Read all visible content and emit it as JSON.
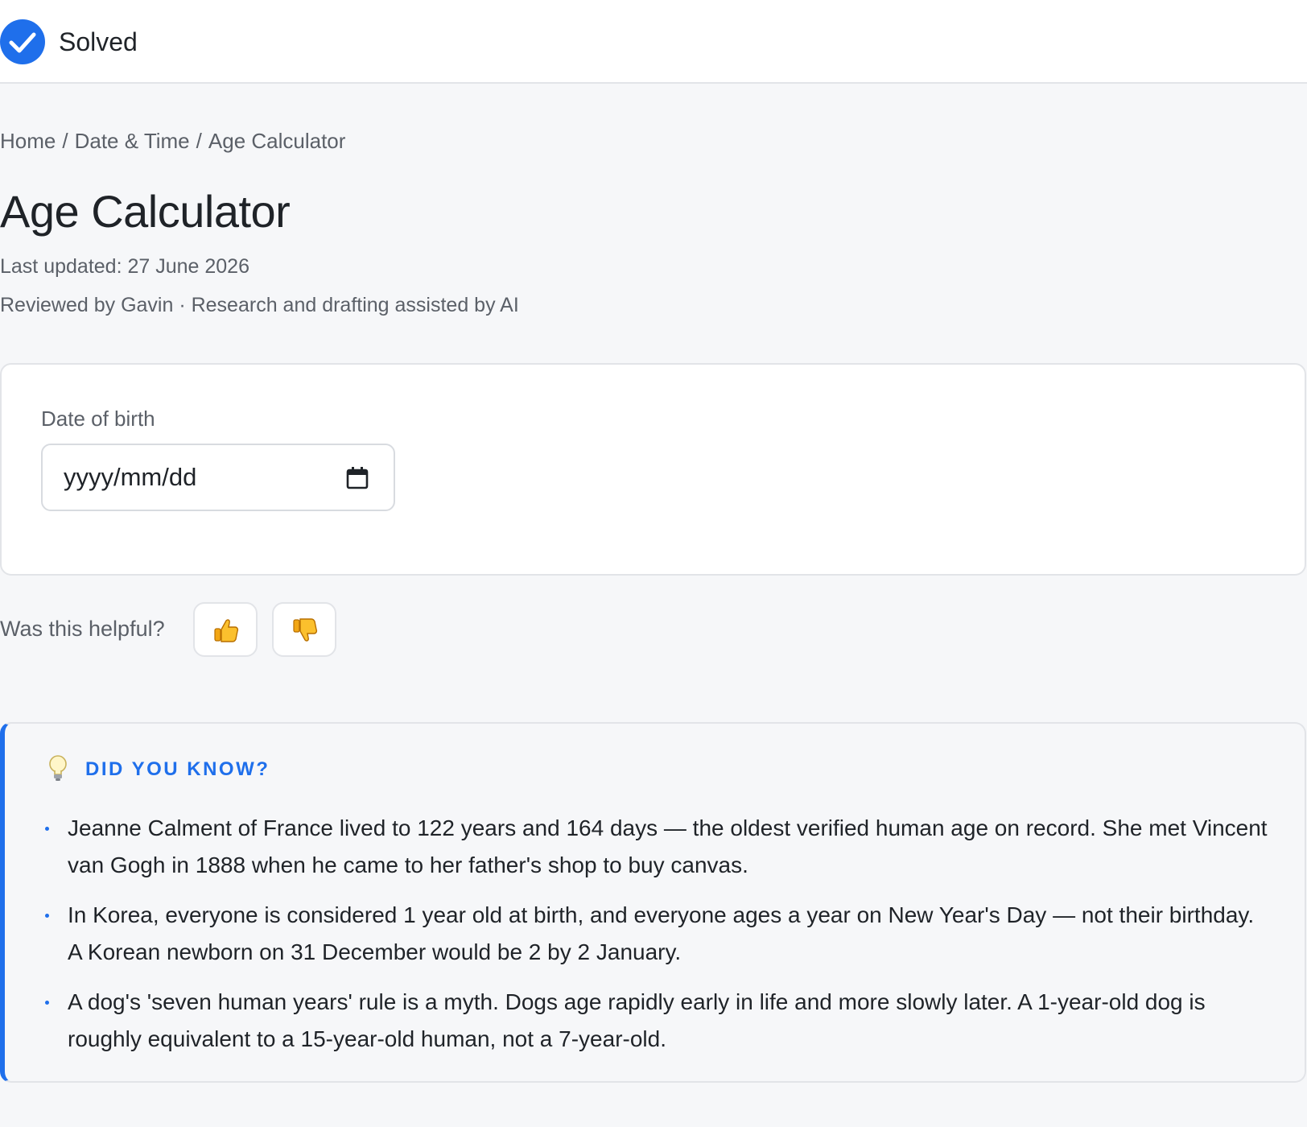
{
  "header": {
    "status_label": "Solved",
    "status_icon": "check-circle-icon",
    "accent_color": "#1f6feb"
  },
  "breadcrumb": {
    "items": [
      "Home",
      "Date & Time",
      "Age Calculator"
    ],
    "separator": "/"
  },
  "page": {
    "title": "Age Calculator",
    "last_updated": "Last updated: 27 June 2026",
    "reviewed": "Reviewed by Gavin · Research and drafting assisted by AI"
  },
  "calculator": {
    "dob_label": "Date of birth",
    "dob_placeholder": "yyyy/mm/dd",
    "calendar_icon": "calendar-icon"
  },
  "feedback": {
    "question": "Was this helpful?",
    "up_icon": "thumbs-up-icon",
    "down_icon": "thumbs-down-icon"
  },
  "facts": {
    "icon": "lightbulb-icon",
    "heading": "DID YOU KNOW?",
    "items": [
      "Jeanne Calment of France lived to 122 years and 164 days — the oldest verified human age on record. She met Vincent van Gogh in 1888 when he came to her father's shop to buy canvas.",
      "In Korea, everyone is considered 1 year old at birth, and everyone ages a year on New Year's Day — not their birthday. A Korean newborn on 31 December would be 2 by 2 January.",
      "A dog's 'seven human years' rule is a myth. Dogs age rapidly early in life and more slowly later. A 1-year-old dog is roughly equivalent to a 15-year-old human, not a 7-year-old."
    ]
  }
}
